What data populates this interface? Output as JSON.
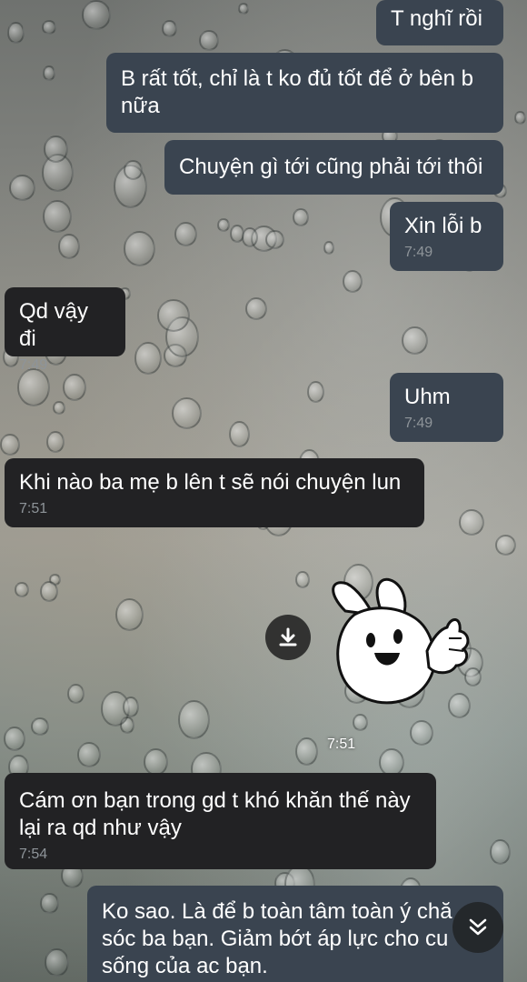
{
  "messages": [
    {
      "id": "m1",
      "direction": "out",
      "text": "T nghĩ rồi",
      "time": ""
    },
    {
      "id": "m2",
      "direction": "out",
      "text": "B rất tốt, chỉ là t ko đủ tốt để ở bên b\nnữa",
      "time": ""
    },
    {
      "id": "m3",
      "direction": "out",
      "text": "Chuyện gì tới cũng phải tới thôi",
      "time": ""
    },
    {
      "id": "m4",
      "direction": "out",
      "text": "Xin lỗi b",
      "time": "7:49"
    },
    {
      "id": "m5",
      "direction": "in",
      "text": "Qd vậy đi",
      "time": "7:49"
    },
    {
      "id": "m6",
      "direction": "out",
      "text": "Uhm",
      "time": "7:49"
    },
    {
      "id": "m7",
      "direction": "in",
      "text": "Khi nào ba mẹ b lên t sẽ nói chuyện lun",
      "time": "7:51"
    },
    {
      "id": "m8",
      "direction": "in",
      "text": "Cám ơn bạn trong gd t khó khăn thế này\nlại ra qd như vậy",
      "time": "7:54"
    },
    {
      "id": "m9",
      "direction": "out",
      "text": "Ko sao. Là để b toàn tâm toàn ý chă\nsóc ba bạn. Giảm bớt áp lực cho cu\nsống của ac bạn.",
      "time": ""
    }
  ],
  "sticker": {
    "icon": "thumbs-up-bunny-sticker",
    "time": "7:51"
  },
  "controls": {
    "download_icon": "download-icon",
    "scroll_down_icon": "double-chevron-down-icon"
  }
}
